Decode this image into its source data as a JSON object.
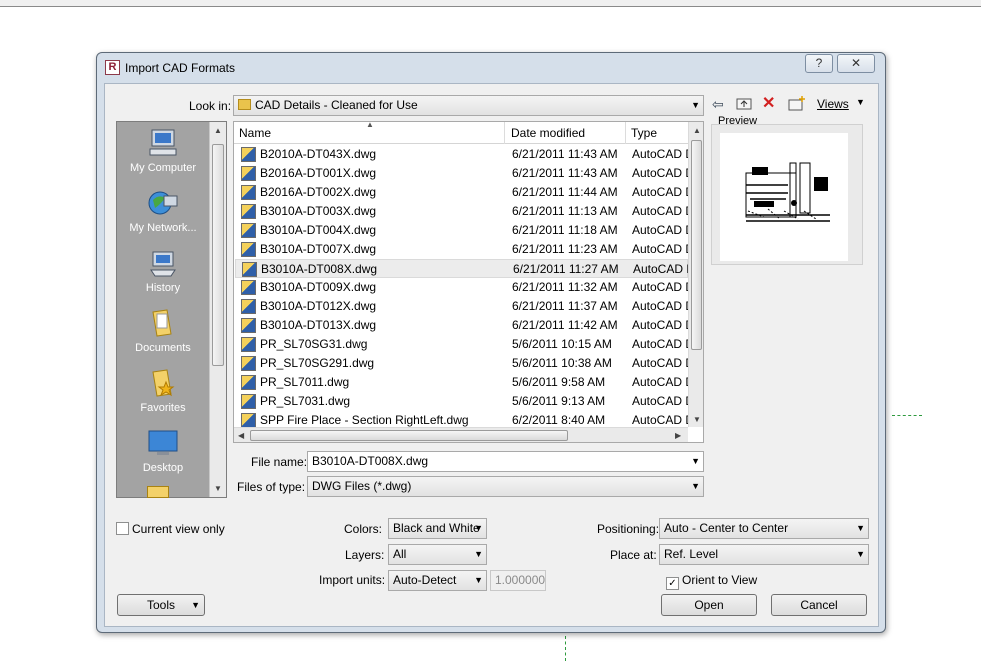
{
  "dialog": {
    "title": "Import CAD Formats",
    "app_icon_letter": "R",
    "help_glyph": "?",
    "close_glyph": "✕"
  },
  "look_in": {
    "label": "Look in:",
    "value": "CAD Details - Cleaned for Use"
  },
  "toolbar": {
    "views_label": "Views"
  },
  "places": [
    {
      "label": "My Computer",
      "icon": "computer-icon"
    },
    {
      "label": "My Network...",
      "icon": "network-icon"
    },
    {
      "label": "History",
      "icon": "history-icon"
    },
    {
      "label": "Documents",
      "icon": "documents-folder-icon"
    },
    {
      "label": "Favorites",
      "icon": "favorites-folder-icon"
    },
    {
      "label": "Desktop",
      "icon": "desktop-icon"
    }
  ],
  "file_list": {
    "columns": [
      "Name",
      "Date modified",
      "Type"
    ],
    "rows": [
      {
        "name": "B2010A-DT043X.dwg",
        "date": "6/21/2011 11:43 AM",
        "type": "AutoCAD D"
      },
      {
        "name": "B2016A-DT001X.dwg",
        "date": "6/21/2011 11:43 AM",
        "type": "AutoCAD D"
      },
      {
        "name": "B2016A-DT002X.dwg",
        "date": "6/21/2011 11:44 AM",
        "type": "AutoCAD D"
      },
      {
        "name": "B3010A-DT003X.dwg",
        "date": "6/21/2011 11:13 AM",
        "type": "AutoCAD D"
      },
      {
        "name": "B3010A-DT004X.dwg",
        "date": "6/21/2011 11:18 AM",
        "type": "AutoCAD D"
      },
      {
        "name": "B3010A-DT007X.dwg",
        "date": "6/21/2011 11:23 AM",
        "type": "AutoCAD D"
      },
      {
        "name": "B3010A-DT008X.dwg",
        "date": "6/21/2011 11:27 AM",
        "type": "AutoCAD D",
        "selected": true
      },
      {
        "name": "B3010A-DT009X.dwg",
        "date": "6/21/2011 11:32 AM",
        "type": "AutoCAD D"
      },
      {
        "name": "B3010A-DT012X.dwg",
        "date": "6/21/2011 11:37 AM",
        "type": "AutoCAD D"
      },
      {
        "name": "B3010A-DT013X.dwg",
        "date": "6/21/2011 11:42 AM",
        "type": "AutoCAD D"
      },
      {
        "name": "PR_SL70SG31.dwg",
        "date": "5/6/2011 10:15 AM",
        "type": "AutoCAD D"
      },
      {
        "name": "PR_SL70SG291.dwg",
        "date": "5/6/2011 10:38 AM",
        "type": "AutoCAD D"
      },
      {
        "name": "PR_SL7011.dwg",
        "date": "5/6/2011 9:58 AM",
        "type": "AutoCAD D"
      },
      {
        "name": "PR_SL7031.dwg",
        "date": "5/6/2011 9:13 AM",
        "type": "AutoCAD D"
      },
      {
        "name": "SPP Fire Place - Section RightLeft.dwg",
        "date": "6/2/2011 8:40 AM",
        "type": "AutoCAD D"
      }
    ]
  },
  "preview": {
    "label": "Preview"
  },
  "file_name": {
    "label": "File name:",
    "value": "B3010A-DT008X.dwg"
  },
  "file_type": {
    "label": "Files of type:",
    "value": "DWG Files  (*.dwg)"
  },
  "options": {
    "current_view_only": {
      "label": "Current view only",
      "checked": false
    },
    "colors": {
      "label": "Colors:",
      "value": "Black and White"
    },
    "layers": {
      "label": "Layers:",
      "value": "All"
    },
    "import_units": {
      "label": "Import units:",
      "value": "Auto-Detect",
      "scale": "1.000000"
    },
    "positioning": {
      "label": "Positioning:",
      "value": "Auto - Center to Center"
    },
    "place_at": {
      "label": "Place at:",
      "value": "Ref. Level"
    },
    "orient_to_view": {
      "label": "Orient to View",
      "checked": true,
      "check_glyph": "✓"
    }
  },
  "buttons": {
    "tools": "Tools",
    "open": "Open",
    "cancel": "Cancel"
  }
}
